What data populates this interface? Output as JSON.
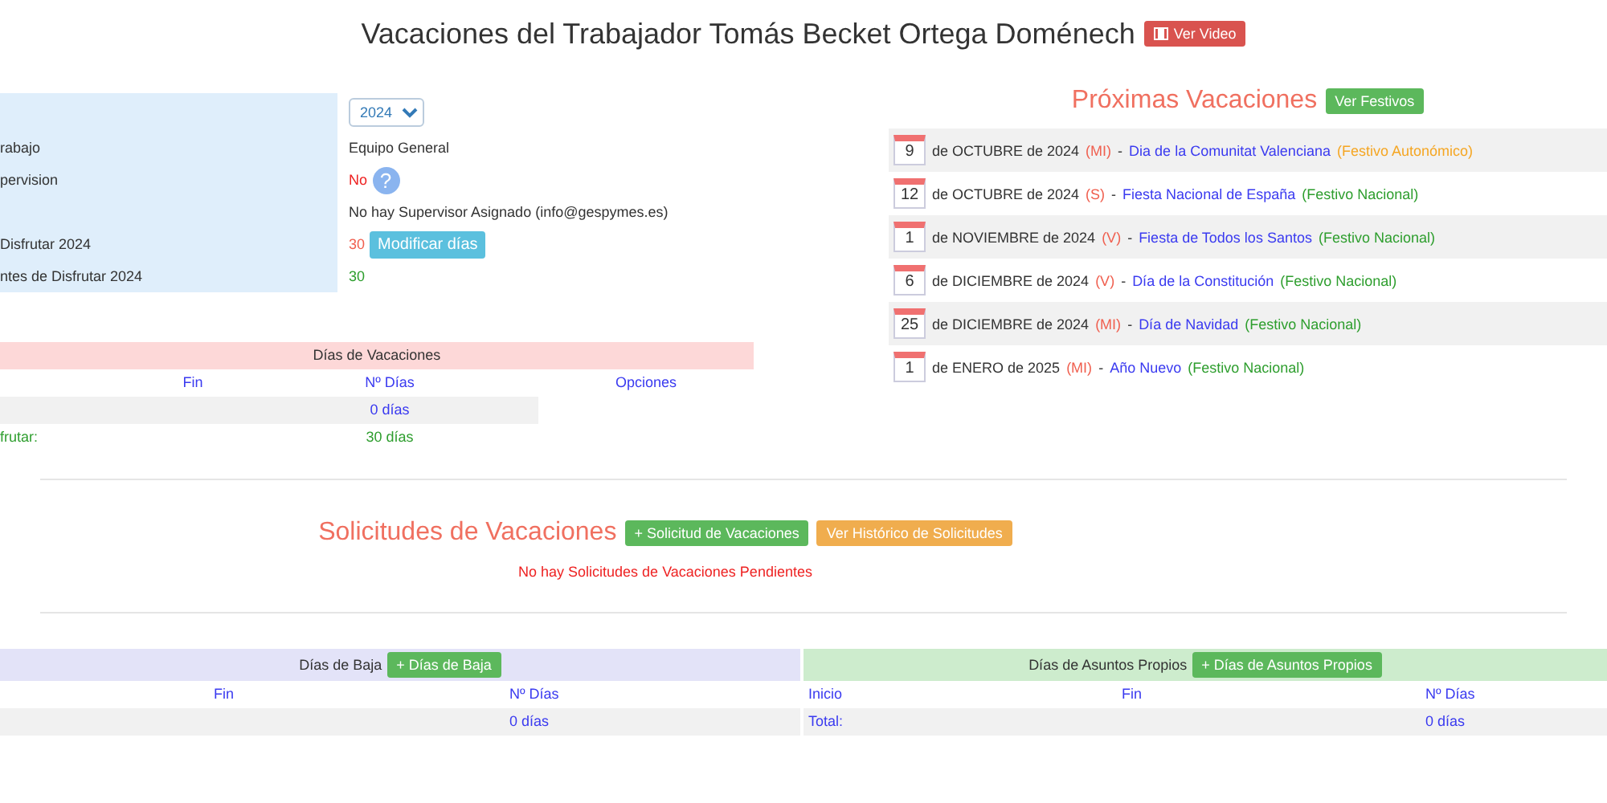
{
  "title": "Vacaciones del Trabajador Tomás Becket Ortega Doménech",
  "video_button": "Ver Video",
  "info": {
    "rows": [
      {
        "kind": "select",
        "label": "",
        "value": "2024"
      },
      {
        "kind": "text",
        "label": "rabajo",
        "value": "Equipo General"
      },
      {
        "kind": "status",
        "label": "pervision",
        "value": "No",
        "help": "?"
      },
      {
        "kind": "text",
        "label": "",
        "value": "No hay Supervisor Asignado (info@gespymes.es)"
      },
      {
        "kind": "days",
        "label": "Disfrutar 2024",
        "value": "30",
        "button": "Modificar días"
      },
      {
        "kind": "remaining",
        "label": "ntes de Disfrutar 2024",
        "value": "30"
      }
    ]
  },
  "vacations": {
    "title": "Días de Vacaciones",
    "columns": [
      "Fin",
      "Nº Días",
      "Opciones"
    ],
    "total": {
      "days": "0 días"
    },
    "remaining": {
      "label": "frutar:",
      "days": "30 días"
    }
  },
  "upcoming": {
    "title": "Próximas Vacaciones",
    "button": "Ver Festivos",
    "items": [
      {
        "day": "9",
        "date": "de OCTUBRE de 2024",
        "weekday": "(MI)",
        "sep": "-",
        "name": "Dia de la Comunitat Valenciana",
        "type": "(Festivo Autonómico)",
        "color": "#f5a623"
      },
      {
        "day": "12",
        "date": "de OCTUBRE de 2024",
        "weekday": "(S)",
        "sep": "-",
        "name": "Fiesta Nacional de España",
        "type": "(Festivo Nacional)",
        "color": "#2e9e2e"
      },
      {
        "day": "1",
        "date": "de NOVIEMBRE de 2024",
        "weekday": "(V)",
        "sep": "-",
        "name": "Fiesta de Todos los Santos",
        "type": "(Festivo Nacional)",
        "color": "#2e9e2e"
      },
      {
        "day": "6",
        "date": "de DICIEMBRE de 2024",
        "weekday": "(V)",
        "sep": "-",
        "name": "Día de la Constitución",
        "type": "(Festivo Nacional)",
        "color": "#2e9e2e"
      },
      {
        "day": "25",
        "date": "de DICIEMBRE de 2024",
        "weekday": "(MI)",
        "sep": "-",
        "name": "Día de Navidad",
        "type": "(Festivo Nacional)",
        "color": "#2e9e2e"
      },
      {
        "day": "1",
        "date": "de ENERO de 2025",
        "weekday": "(MI)",
        "sep": "-",
        "name": "Año Nuevo",
        "type": "(Festivo Nacional)",
        "color": "#2e9e2e"
      }
    ]
  },
  "requests": {
    "title": "Solicitudes de Vacaciones",
    "new_button": "+ Solicitud de Vacaciones",
    "history_button": "Ver Histórico de Solicitudes",
    "empty": "No hay Solicitudes de Vacaciones Pendientes"
  },
  "leave": {
    "title": "Días de Baja",
    "button": "+ Días de Baja",
    "columns": [
      "Fin",
      "Nº Días"
    ],
    "total": {
      "days": "0 días"
    }
  },
  "personal": {
    "title": "Días de Asuntos Propios",
    "button": "+ Días de Asuntos Propios",
    "columns": [
      "Inicio",
      "Fin",
      "Nº Días"
    ],
    "total": {
      "label": "Total:",
      "days": "0 días"
    }
  }
}
